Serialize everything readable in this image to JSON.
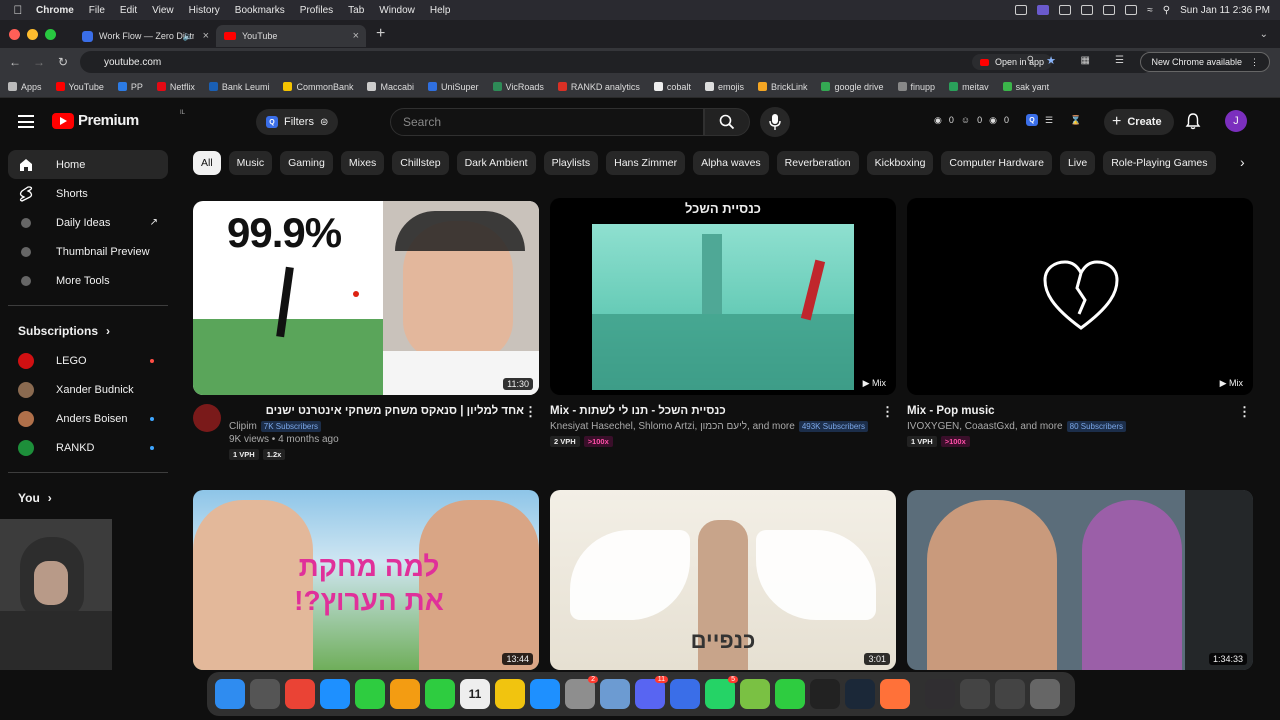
{
  "menubar": {
    "app": "Chrome",
    "items": [
      "File",
      "Edit",
      "View",
      "History",
      "Bookmarks",
      "Profiles",
      "Tab",
      "Window",
      "Help"
    ],
    "datetime": "Sun Jan 11  2:36 PM"
  },
  "tabs": [
    {
      "title": "Work Flow — Zero Distrac",
      "active": false
    },
    {
      "title": "YouTube",
      "active": true
    }
  ],
  "address": {
    "url": "youtube.com",
    "open_in_app": "Open in app",
    "chrome_available": "New Chrome available"
  },
  "bookmarks": [
    {
      "label": "Apps",
      "icon": "apps-grid-icon",
      "color": "#bbbbbb"
    },
    {
      "label": "YouTube",
      "icon": "youtube-icon",
      "color": "#ff0000"
    },
    {
      "label": "PP",
      "icon": "paypal-icon",
      "color": "#2c7be5"
    },
    {
      "label": "Netflix",
      "icon": "netflix-icon",
      "color": "#e50914"
    },
    {
      "label": "Bank Leumi",
      "icon": "bank-icon",
      "color": "#1a5fb4"
    },
    {
      "label": "CommonBank",
      "icon": "commonbank-icon",
      "color": "#f5c400"
    },
    {
      "label": "Maccabi",
      "icon": "maccabi-icon",
      "color": "#cccccc"
    },
    {
      "label": "UniSuper",
      "icon": "unisuper-icon",
      "color": "#2f6fdf"
    },
    {
      "label": "VicRoads",
      "icon": "vicroads-icon",
      "color": "#2e8b57"
    },
    {
      "label": "RANKD analytics",
      "icon": "rankd-icon",
      "color": "#d93025"
    },
    {
      "label": "cobalt",
      "icon": "cobalt-icon",
      "color": "#eeeeee"
    },
    {
      "label": "emojis",
      "icon": "emoji-icon",
      "color": "#dddddd"
    },
    {
      "label": "BrickLink",
      "icon": "bricklink-icon",
      "color": "#f5a623"
    },
    {
      "label": "google drive",
      "icon": "drive-icon",
      "color": "#34a853"
    },
    {
      "label": "finupp",
      "icon": "finupp-icon",
      "color": "#888888"
    },
    {
      "label": "meitav",
      "icon": "meitav-icon",
      "color": "#2aa05a"
    },
    {
      "label": "sak yant",
      "icon": "sakyant-icon",
      "color": "#3bb54a"
    }
  ],
  "header": {
    "logo_text": "Premium",
    "logo_region": "IL",
    "filters_label": "Filters",
    "search_placeholder": "Search",
    "stats": [
      "0",
      "0",
      "0"
    ],
    "create_label": "Create",
    "avatar_letter": "J"
  },
  "sidebar": {
    "main": [
      {
        "label": "Home",
        "icon": "home-icon",
        "active": true
      },
      {
        "label": "Shorts",
        "icon": "shorts-icon",
        "active": false
      },
      {
        "label": "Daily Ideas",
        "icon": "extension-icon",
        "active": false
      },
      {
        "label": "Thumbnail Preview",
        "icon": "extension-icon",
        "active": false
      },
      {
        "label": "More Tools",
        "icon": "extension-icon",
        "active": false
      }
    ],
    "subscriptions_label": "Subscriptions",
    "subscriptions": [
      {
        "label": "LEGO",
        "color": "#d01012",
        "live": true
      },
      {
        "label": "Xander Budnick",
        "color": "#8a6a50",
        "live": false
      },
      {
        "label": "Anders Boisen",
        "color": "#b0704a",
        "live": true
      },
      {
        "label": "RANKD",
        "color": "#1d8f3a",
        "live": true
      }
    ],
    "you_label": "You"
  },
  "chips": [
    "All",
    "Music",
    "Gaming",
    "Mixes",
    "Chillstep",
    "Dark Ambient",
    "Playlists",
    "Hans Zimmer",
    "Alpha waves",
    "Reverberation",
    "Kickboxing",
    "Computer Hardware",
    "Live",
    "Role-Playing Games"
  ],
  "videos": [
    {
      "title": "אחד למליון | סנאקס משחק משחקי אינטרנט ישנים",
      "channel": "Clipim",
      "subscribers": "7K Subscribers",
      "stats": "9K views • 4 months ago",
      "tags": [
        "1 VPH",
        "1.2x"
      ],
      "duration": "11:30",
      "thumb_text": "99.9%"
    },
    {
      "title": "Mix - כנסיית השכל - תנו לי לשתות",
      "channel": "Knesiyat Hasechel, Shlomo Artzi, ליעם הכמון, and more",
      "subscribers": "493K Subscribers",
      "tags": [
        "2 VPH",
        ">100x"
      ],
      "duration": "Mix",
      "thumb_text": "כנסיית השכל"
    },
    {
      "title": "Mix - Pop music",
      "channel": "IVOXYGEN, CoaastGxd, and more",
      "subscribers": "80 Subscribers",
      "tags": [
        "1 VPH",
        ">100x"
      ],
      "duration": "Mix"
    },
    {
      "duration": "13:44",
      "thumb_text": "למה מחקת את הערוץ?!"
    },
    {
      "duration": "3:01",
      "thumb_text": "כנפיים"
    },
    {
      "duration": "1:34:33"
    }
  ],
  "dock": [
    {
      "icon": "finder-icon",
      "color": "#2f8cf0"
    },
    {
      "icon": "launchpad-icon",
      "color": "#555555"
    },
    {
      "icon": "chrome-icon",
      "color": "#ea4335"
    },
    {
      "icon": "safari-icon",
      "color": "#1e90ff"
    },
    {
      "icon": "messages-icon",
      "color": "#2ecc40"
    },
    {
      "icon": "photos-icon",
      "color": "#f39c12"
    },
    {
      "icon": "facetime-icon",
      "color": "#2ecc40"
    },
    {
      "icon": "calendar-icon",
      "color": "#eeeeee",
      "text": "11"
    },
    {
      "icon": "notes-icon",
      "color": "#f1c40f"
    },
    {
      "icon": "app-store-icon",
      "color": "#1e90ff"
    },
    {
      "icon": "system-settings-icon",
      "color": "#8e8e8e",
      "badge": "2"
    },
    {
      "icon": "preview-icon",
      "color": "#6c9bd2"
    },
    {
      "icon": "discord-icon",
      "color": "#5865f2",
      "badge": "11"
    },
    {
      "icon": "arc-icon",
      "color": "#3a6ee8"
    },
    {
      "icon": "whatsapp-icon",
      "color": "#25d366",
      "badge": "5"
    },
    {
      "icon": "vectorworks-icon",
      "color": "#7ac143"
    },
    {
      "icon": "robinhood-icon",
      "color": "#2ecc40"
    },
    {
      "icon": "capcut-icon",
      "color": "#222222"
    },
    {
      "icon": "steam-icon",
      "color": "#1b2838"
    },
    {
      "icon": "firefox-icon",
      "color": "#ff7139"
    },
    {
      "icon": "obs-icon",
      "color": "#302e31"
    },
    {
      "icon": "screen-icon",
      "color": "#444444"
    },
    {
      "icon": "folder-icon",
      "color": "#444444"
    },
    {
      "icon": "trash-icon",
      "color": "#666666"
    }
  ]
}
